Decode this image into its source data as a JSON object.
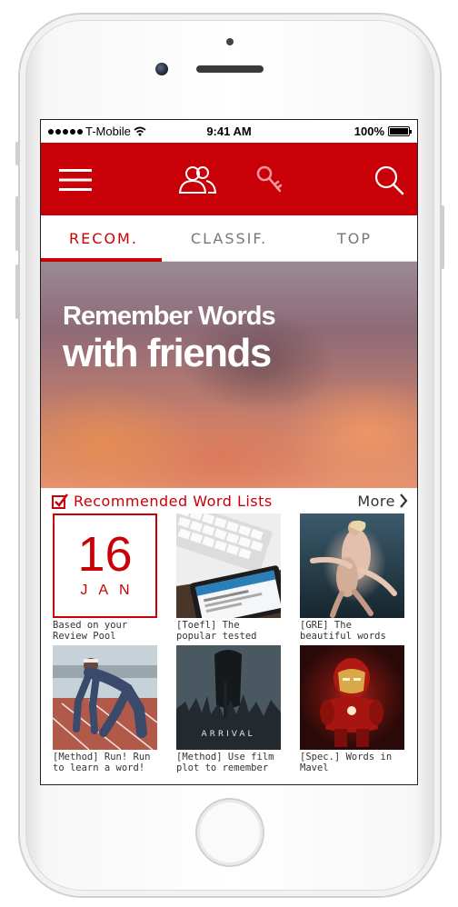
{
  "status": {
    "carrier": "T-Mobile",
    "time": "9:41 AM",
    "battery": "100%"
  },
  "appbar": {
    "icons": [
      "menu-icon",
      "friends-icon",
      "key-icon",
      "search-icon"
    ],
    "accent": "#c90008"
  },
  "tabs": [
    {
      "label": "RECOM.",
      "active": true
    },
    {
      "label": "CLASSIF.",
      "active": false
    },
    {
      "label": "TOP",
      "active": false
    }
  ],
  "hero": {
    "line1": "Remember Words",
    "line2": "with friends"
  },
  "section": {
    "title": "Recommended Word Lists",
    "more": "More"
  },
  "cards": [
    {
      "day": "16",
      "month": "JAN",
      "caption": "Based on your Review Pool"
    },
    {
      "caption": "[Toefl] The popular tested Technology words"
    },
    {
      "caption": "[GRE] The beautiful words about love"
    },
    {
      "caption": "[Method] Run! Run to learn a word!"
    },
    {
      "caption": "[Method] Use film plot to remember"
    },
    {
      "caption": "[Spec.] Words in Mavel"
    }
  ],
  "arrival_poster_text": "ARRIVAL"
}
